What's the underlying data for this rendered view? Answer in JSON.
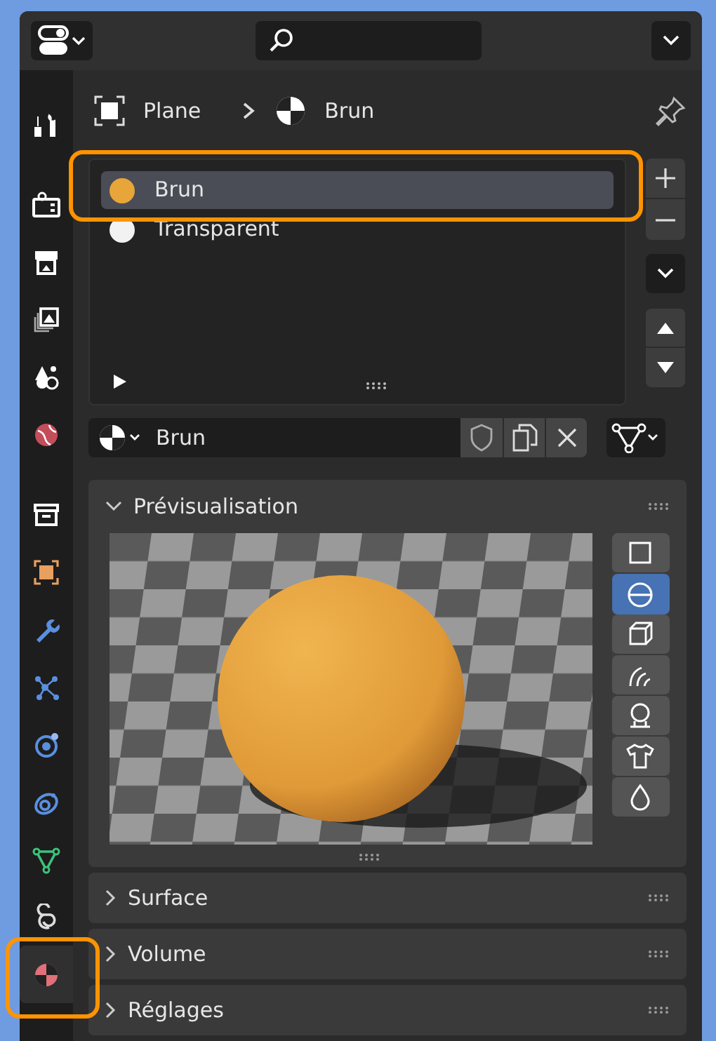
{
  "tabs": [
    {
      "selected": false
    },
    {
      "selected": false
    },
    {
      "selected": false
    },
    {
      "selected": false
    },
    {
      "selected": false
    },
    {
      "selected": false
    },
    {
      "selected": false
    },
    {
      "selected": false
    },
    {
      "selected": false
    },
    {
      "selected": false
    },
    {
      "selected": false
    },
    {
      "selected": false
    },
    {
      "selected": false
    },
    {
      "selected": false
    },
    {
      "selected": true
    }
  ],
  "breadcrumb": [
    "Plane",
    "Brun"
  ],
  "material_slots": [
    {
      "name": "Brun",
      "color": "#e8a53a",
      "selected": true
    },
    {
      "name": "Transparent",
      "color": "#f2f2f2",
      "selected": false
    }
  ],
  "material_datablock": {
    "value": "Brun"
  },
  "panels": [
    {
      "title": "Prévisualisation",
      "expanded": true,
      "preview_shapes": [
        {
          "selected": false
        },
        {
          "selected": true
        },
        {
          "selected": false
        },
        {
          "selected": false
        },
        {
          "selected": false
        },
        {
          "selected": false
        },
        {
          "selected": false
        }
      ]
    },
    {
      "title": "Surface",
      "expanded": false
    },
    {
      "title": "Volume",
      "expanded": false
    },
    {
      "title": "Réglages",
      "expanded": false
    }
  ]
}
